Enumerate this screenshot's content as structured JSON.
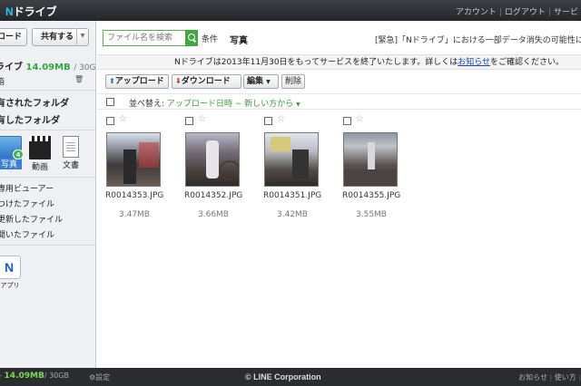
{
  "header": {
    "logo_n": "N",
    "logo_rest": "ドライブ",
    "nav": [
      "アカウント",
      "ログアウト",
      "サービ"
    ]
  },
  "sidebar": {
    "upload_label": "ロード",
    "share_label": "共有する",
    "quota_prefix": "ライブ",
    "quota_used": "14.09MB",
    "quota_total": "/ 30GB",
    "trash_label": "箱",
    "folders": [
      "有されたフォルダ",
      "有したフォルダ"
    ],
    "file_types": [
      {
        "label": "写真",
        "badge": "4"
      },
      {
        "label": "動画"
      },
      {
        "label": "文書"
      }
    ],
    "lists": [
      "専用ビューアー",
      "つけたファイル",
      "更新したファイル",
      "開いたファイル"
    ],
    "app_label": "アプリ",
    "app_icon_letter": "N"
  },
  "search": {
    "placeholder": "ファイル名を検索",
    "condition_label": "条件",
    "tab_label": "写真",
    "urgent_notice": "[緊急]「Nドライブ」における一部データ消失の可能性に関する"
  },
  "notice": {
    "text": "Nドライブは2013年11月30日をもってサービスを終了いたします。詳しくは",
    "link": "お知らせ",
    "suffix": "をご確認ください。"
  },
  "toolbar": {
    "upload": "アップロード",
    "download": "ダウンロード",
    "edit": "編集",
    "delete": "削除"
  },
  "sort": {
    "label": "並べ替え:",
    "value": "アップロード日時 − 新しい方から"
  },
  "files": [
    {
      "name": "R0014353.JPG",
      "size": "3.47MB"
    },
    {
      "name": "R0014352.JPG",
      "size": "3.66MB"
    },
    {
      "name": "R0014351.JPG",
      "size": "3.42MB"
    },
    {
      "name": "R0014355.JPG",
      "size": "3.55MB"
    }
  ],
  "footer": {
    "quota_used": "14.09MB",
    "quota_total": "/ 30GB",
    "settings": "設定",
    "copyright": "© LINE Corporation",
    "links": [
      "お知らせ",
      "使い方"
    ]
  },
  "colors": {
    "accent_green": "#43a83f",
    "photo_blue": "#3a7fd5",
    "topbar": "#2b2d31"
  },
  "icons": [
    "search-icon",
    "star-icon",
    "trash-icon",
    "camera-icon",
    "film-icon",
    "document-icon",
    "upload-arrow-icon",
    "download-arrow-icon",
    "gear-icon",
    "app-icon"
  ]
}
